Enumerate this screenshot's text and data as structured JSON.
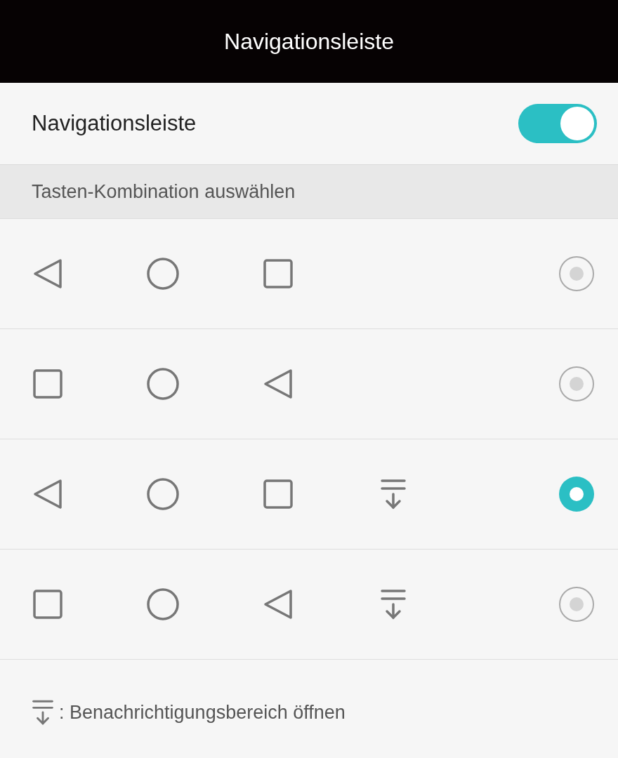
{
  "title_bar": {
    "title": "Navigationsleiste"
  },
  "toggle_row": {
    "label": "Navigationsleiste",
    "on": true
  },
  "section_header": "Tasten-Kombination auswählen",
  "options": [
    {
      "buttons": [
        {
          "kind": "back"
        },
        {
          "kind": "home"
        },
        {
          "kind": "recent"
        }
      ],
      "selected": false
    },
    {
      "buttons": [
        {
          "kind": "recent"
        },
        {
          "kind": "home"
        },
        {
          "kind": "back"
        }
      ],
      "selected": false
    },
    {
      "buttons": [
        {
          "kind": "back"
        },
        {
          "kind": "home"
        },
        {
          "kind": "recent"
        },
        {
          "kind": "notifications"
        }
      ],
      "selected": true
    },
    {
      "buttons": [
        {
          "kind": "recent"
        },
        {
          "kind": "home"
        },
        {
          "kind": "back"
        },
        {
          "kind": "notifications"
        }
      ],
      "selected": false
    }
  ],
  "legend": {
    "text": ": Benachrichtigungsbereich öffnen"
  }
}
